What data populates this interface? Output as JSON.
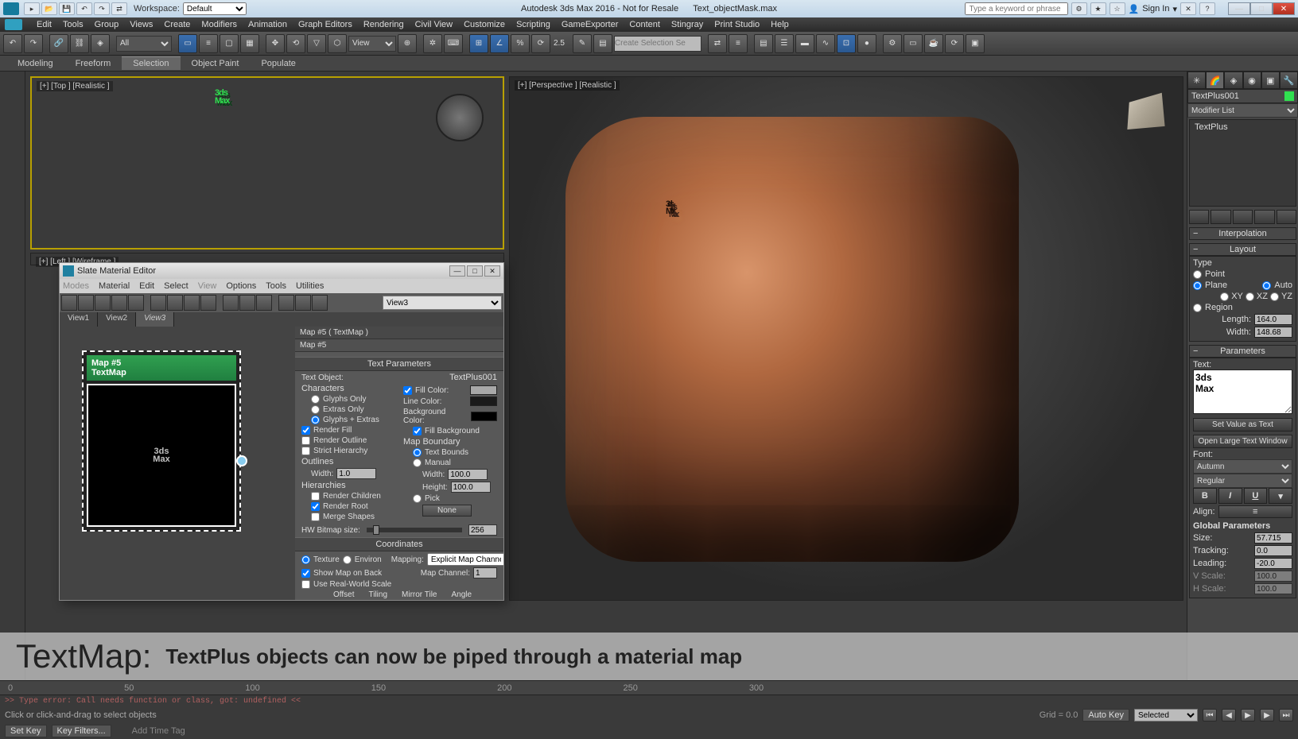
{
  "titlebar": {
    "workspace_label": "Workspace:",
    "workspace_value": "Default",
    "app_title": "Autodesk 3ds Max 2016 - Not for Resale",
    "doc_title": "Text_objectMask.max",
    "search_placeholder": "Type a keyword or phrase",
    "signin": "Sign In"
  },
  "menubar": {
    "items": [
      "Edit",
      "Tools",
      "Group",
      "Views",
      "Create",
      "Modifiers",
      "Animation",
      "Graph Editors",
      "Rendering",
      "Civil View",
      "Customize",
      "Scripting",
      "GameExporter",
      "Content",
      "Stingray",
      "Print Studio",
      "Help"
    ]
  },
  "toolbar": {
    "all_label": "All",
    "view_label": "View",
    "spinner_val": "2.5",
    "create_sel_placeholder": "Create Selection Se"
  },
  "ribbon": {
    "tabs": [
      "Modeling",
      "Freeform",
      "Selection",
      "Object Paint",
      "Populate"
    ],
    "active_index": 2
  },
  "viewports": {
    "top_label": "[+] [Top ] [Realistic ]",
    "left_label": "[+] [Left ] [Wireframe ]",
    "persp_label": "[+] [Perspective ] [Realistic ]",
    "logo_line1": "3ds",
    "logo_line2": "Max"
  },
  "mateditor": {
    "title": "Slate Material Editor",
    "menu": [
      "Modes",
      "Material",
      "Edit",
      "Select",
      "View",
      "Options",
      "Tools",
      "Utilities"
    ],
    "view_select": "View3",
    "tabs": [
      "View1",
      "View2",
      "View3"
    ],
    "active_tab": 2,
    "node": {
      "title": "Map #5",
      "subtitle": "TextMap"
    },
    "params_header": "Map #5  ( TextMap )",
    "params_sub": "Map #5",
    "sec_text_params": "Text Parameters",
    "text_object_label": "Text Object:",
    "text_object_value": "TextPlus001",
    "characters_label": "Characters",
    "glyphs_only": "Glyphs Only",
    "extras_only": "Extras Only",
    "glyphs_extras": "Glyphs + Extras",
    "render_fill": "Render Fill",
    "render_outline": "Render Outline",
    "strict_hierarchy": "Strict Hierarchy",
    "outlines_label": "Outlines",
    "width_label": "Width:",
    "outline_width": "1.0",
    "hierarchies_label": "Hierarchies",
    "render_children": "Render Children",
    "render_root": "Render Root",
    "merge_shapes": "Merge Shapes",
    "hw_bitmap_label": "HW Bitmap size:",
    "hw_bitmap_value": "256",
    "fill_color_label": "Fill Color:",
    "line_color_label": "Line Color:",
    "bg_color_label": "Background Color:",
    "fill_bg": "Fill Background",
    "map_boundary": "Map Boundary",
    "text_bounds": "Text Bounds",
    "manual": "Manual",
    "manual_width": "100.0",
    "height_label": "Height:",
    "manual_height": "100.0",
    "pick": "Pick",
    "none_btn": "None",
    "coordinates": "Coordinates",
    "texture": "Texture",
    "environ": "Environ",
    "mapping_label": "Mapping:",
    "mapping_value": "Explicit Map Channel",
    "show_map_back": "Show Map on Back",
    "map_channel_label": "Map Channel:",
    "map_channel_value": "1",
    "real_world": "Use Real-World Scale",
    "coord_headers": [
      "Offset",
      "Tiling",
      "Mirror Tile",
      "Angle"
    ],
    "fill_color": "#a8a8a8",
    "line_color": "#1a1a1a",
    "bg_color": "#000000"
  },
  "cmdpanel": {
    "obj_name": "TextPlus001",
    "obj_color": "#30e050",
    "mod_list_label": "Modifier List",
    "stack_item": "TextPlus",
    "rollouts": {
      "interpolation": "Interpolation",
      "layout": "Layout",
      "type_label": "Type",
      "point": "Point",
      "plane": "Plane",
      "auto": "Auto",
      "xy": "XY",
      "xz": "XZ",
      "yz": "YZ",
      "region": "Region",
      "length_label": "Length:",
      "length_val": "164.0",
      "width_label": "Width:",
      "width_val": "148.68",
      "parameters": "Parameters",
      "text_label": "Text:",
      "text_value": "3ds \nMax",
      "set_value": "Set Value as Text",
      "open_large": "Open Large Text Window",
      "font_label": "Font:",
      "font_value": "Autumn",
      "style_value": "Regular",
      "align_label": "Align:",
      "global_params": "Global Parameters",
      "size_label": "Size:",
      "size_val": "57.715",
      "tracking_label": "Tracking:",
      "tracking_val": "0.0",
      "leading_label": "Leading:",
      "leading_val": "-20.0",
      "vscale_label": "V Scale:",
      "vscale_val": "100.0",
      "hscale_label": "H Scale:",
      "hscale_val": "100.0"
    }
  },
  "caption": {
    "title": "TextMap:",
    "text": "TextPlus objects can now be piped through a material map"
  },
  "timeline": {
    "frames": [
      "0",
      "50",
      "100",
      "150",
      "200",
      "250",
      "300"
    ]
  },
  "statusbar": {
    "script_error": ">> Type error: Call needs function or class, got: undefined <<",
    "hint": "Click or click-and-drag to select objects",
    "grid_label": "Grid = 0.0",
    "autokey": "Auto Key",
    "setkey": "Set Key",
    "selected": "Selected",
    "keyfilters": "Key Filters...",
    "addtimetag": "Add Time Tag"
  }
}
